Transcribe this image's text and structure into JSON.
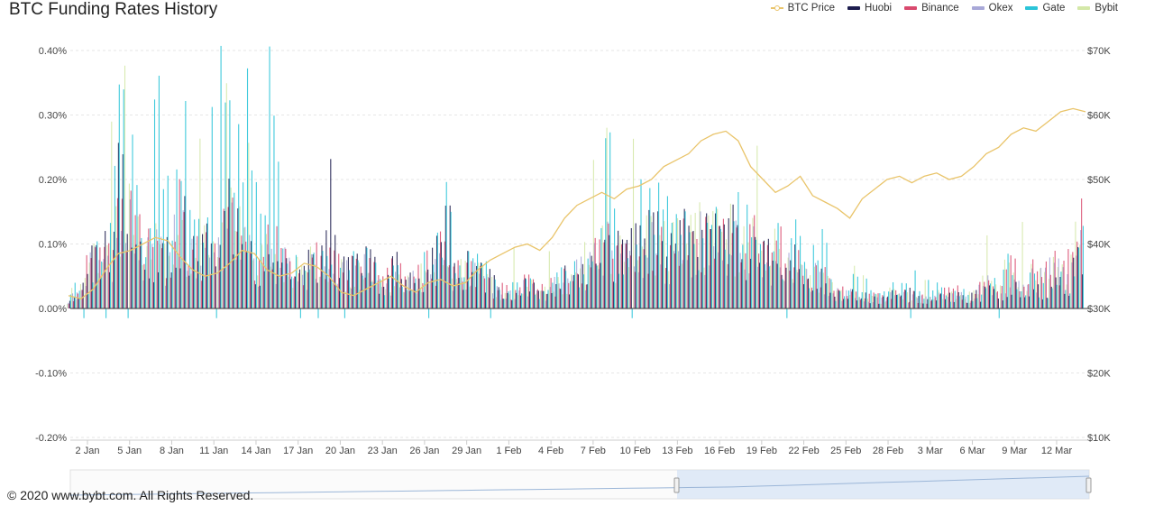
{
  "title": "BTC Funding Rates History",
  "copyright": "© 2020 www.bybt.com. All Rights Reserved.",
  "colors": {
    "btc_price": "#e9c46a",
    "huobi": "#1d1d4e",
    "binance": "#d94a6e",
    "okex": "#a8a8d8",
    "gate": "#2bc4d8",
    "bybit": "#d4e8a8"
  },
  "chart_data": {
    "type": "bar",
    "title": "BTC Funding Rates History",
    "x_ticks": [
      "2 Jan",
      "5 Jan",
      "8 Jan",
      "11 Jan",
      "14 Jan",
      "17 Jan",
      "20 Jan",
      "23 Jan",
      "26 Jan",
      "29 Jan",
      "1 Feb",
      "4 Feb",
      "7 Feb",
      "10 Feb",
      "13 Feb",
      "16 Feb",
      "19 Feb",
      "22 Feb",
      "25 Feb",
      "28 Feb",
      "3 Mar",
      "6 Mar",
      "9 Mar",
      "12 Mar"
    ],
    "y_left_ticks": [
      "0.40%",
      "0.30%",
      "0.20%",
      "0.10%",
      "0.00%",
      "-0.10%",
      "-0.20%"
    ],
    "y_left_range": [
      -0.2,
      0.4
    ],
    "y_right_ticks": [
      "$70K",
      "$60K",
      "$50K",
      "$40K",
      "$30K",
      "$20K",
      "$10K"
    ],
    "y_right_range": [
      10000,
      70000
    ],
    "legend_position": "top-right",
    "grid": true,
    "series": [
      {
        "name": "BTC Price",
        "type": "line",
        "color_key": "btc_price",
        "values_daily": [
          32000,
          31500,
          33000,
          36000,
          38500,
          39000,
          40000,
          41000,
          40500,
          38000,
          36000,
          35000,
          35500,
          37000,
          39000,
          38500,
          36000,
          35000,
          35500,
          37000,
          36500,
          35000,
          32500,
          32000,
          33000,
          34000,
          35000,
          33500,
          32500,
          34000,
          34500,
          33500,
          34000,
          36000,
          37500,
          38500,
          39500,
          40000,
          39000,
          41000,
          44000,
          46000,
          47000,
          48000,
          47000,
          48500,
          49000,
          50000,
          52000,
          53000,
          54000,
          56000,
          57000,
          57500,
          56000,
          52000,
          50000,
          48000,
          49000,
          50500,
          47500,
          46500,
          45500,
          44000,
          47000,
          48500,
          50000,
          50500,
          49500,
          50500,
          51000,
          50000,
          50500,
          52000,
          54000,
          55000,
          57000,
          58000,
          57500,
          59000,
          60500,
          61000,
          60500
        ]
      },
      {
        "name": "Huobi",
        "color_key": "huobi"
      },
      {
        "name": "Binance",
        "color_key": "binance"
      },
      {
        "name": "Okex",
        "color_key": "okex"
      },
      {
        "name": "Gate",
        "color_key": "gate"
      },
      {
        "name": "Bybit",
        "color_key": "bybit"
      }
    ],
    "funding_rate_samples_pct": {
      "Gate": [
        0.04,
        0.03,
        0.08,
        0.12,
        0.37,
        0.37,
        0.1,
        0.35,
        0.12,
        0.29,
        0.15,
        0.2,
        0.37,
        0.3,
        0.37,
        0.2,
        0.37,
        0.15,
        0.08,
        0.1,
        0.1,
        0.05,
        0.06,
        0.09,
        0.08,
        0.04,
        0.07,
        0.05,
        0.06,
        0.12,
        0.19,
        0.06,
        0.08,
        0.17,
        0.04,
        0.03,
        0.05,
        0.04,
        0.03,
        0.05,
        0.06,
        0.07,
        0.12,
        0.25,
        0.1,
        0.13,
        0.2,
        0.22,
        0.13,
        0.16,
        0.14,
        0.18,
        0.12,
        0.15,
        0.16,
        0.13,
        0.12,
        0.1,
        0.12,
        0.05,
        0.14,
        0.03,
        0.02,
        0.06,
        0.04,
        0.02,
        0.04,
        0.08,
        0.03,
        0.04,
        0.02,
        0.03,
        0.02,
        0.03,
        0.05,
        0.09,
        0.04,
        0.05,
        0.03,
        0.05,
        0.04,
        0.12
      ],
      "Huobi": [
        0.02,
        0.03,
        0.1,
        0.11,
        0.27,
        0.23,
        0.08,
        0.12,
        0.1,
        0.15,
        0.1,
        0.12,
        0.14,
        0.18,
        0.14,
        0.08,
        0.12,
        0.1,
        0.06,
        0.08,
        0.09,
        0.2,
        0.06,
        0.08,
        0.09,
        0.05,
        0.08,
        0.05,
        0.06,
        0.09,
        0.19,
        0.06,
        0.08,
        0.07,
        0.04,
        0.03,
        0.04,
        0.04,
        0.03,
        0.05,
        0.06,
        0.07,
        0.1,
        0.12,
        0.1,
        0.13,
        0.12,
        0.14,
        0.11,
        0.13,
        0.12,
        0.14,
        0.12,
        0.13,
        0.12,
        0.11,
        0.1,
        0.1,
        0.08,
        0.05,
        0.06,
        0.03,
        0.02,
        0.03,
        0.02,
        0.02,
        0.03,
        0.03,
        0.02,
        0.02,
        0.02,
        0.03,
        0.02,
        0.03,
        0.03,
        0.03,
        0.04,
        0.03,
        0.03,
        0.04,
        0.05,
        0.1
      ],
      "Binance": [
        0.02,
        0.04,
        0.11,
        0.11,
        0.15,
        0.18,
        0.09,
        0.13,
        0.1,
        0.19,
        0.1,
        0.13,
        0.15,
        0.16,
        0.15,
        0.09,
        0.11,
        0.1,
        0.07,
        0.08,
        0.09,
        0.08,
        0.07,
        0.08,
        0.08,
        0.05,
        0.07,
        0.05,
        0.06,
        0.09,
        0.1,
        0.06,
        0.07,
        0.07,
        0.04,
        0.03,
        0.05,
        0.04,
        0.03,
        0.05,
        0.06,
        0.08,
        0.1,
        0.13,
        0.11,
        0.12,
        0.13,
        0.14,
        0.12,
        0.13,
        0.14,
        0.15,
        0.13,
        0.14,
        0.13,
        0.12,
        0.1,
        0.11,
        0.09,
        0.06,
        0.07,
        0.04,
        0.03,
        0.03,
        0.02,
        0.02,
        0.03,
        0.03,
        0.02,
        0.02,
        0.03,
        0.03,
        0.02,
        0.04,
        0.06,
        0.07,
        0.06,
        0.06,
        0.07,
        0.08,
        0.09,
        0.14
      ]
    }
  }
}
